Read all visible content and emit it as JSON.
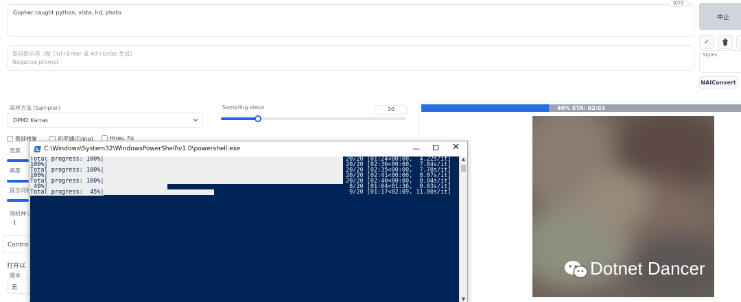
{
  "prompt": {
    "value": "Gopher caught python, vista, hd, photo",
    "counter": "9/75"
  },
  "negative": {
    "line1": "反向提示词（按 Ctrl+Enter 或 Alt+Enter 生成）",
    "line2": "Negative prompt"
  },
  "right_panel": {
    "interrupt": "中止",
    "styles_label": "Styles",
    "naiconvert": "NAIConvert",
    "check_icon": "✓",
    "trash_icon": "trash"
  },
  "sampler": {
    "label": "采样方法 (Sampler)",
    "value": "DPM2 Karras"
  },
  "steps": {
    "label": "Sampling steps",
    "value": "20",
    "fraction": 0.2
  },
  "checks": {
    "restore": "面部修复",
    "tiling": "可平铺(Tiling)",
    "hires": "Hires. fix"
  },
  "left_labels": {
    "width": "宽度",
    "height": "高度",
    "cfg": "提示词相",
    "seed": "随机种子",
    "seed_value": "-1",
    "controlnet": "ControlN",
    "open": "打开以",
    "script": "脚本",
    "script_value": "无"
  },
  "progress": {
    "text": "40% ETA: 02:03",
    "fraction": 0.4
  },
  "watermark": "Dotnet Dancer",
  "powershell": {
    "title": "C:\\Windows\\System32\\WindowsPowerShell\\v1.0\\powershell.exe",
    "lines": [
      {
        "left": "Total progress: 100%|",
        "right": "20/20 [01:24<00:00,  4.22s/it]"
      },
      {
        "left": "100%|",
        "right": "20/20 [02:36<00:00,  7.84s/it]"
      },
      {
        "left": "Total progress: 100%|",
        "right": "20/20 [02:35<00:00,  7.78s/it]"
      },
      {
        "left": "100%|",
        "right": "20/20 [02:41<00:00,  8.07s/it]"
      },
      {
        "left": "Total progress: 100%|",
        "right": "20/20 [02:40<00:00,  8.04s/it]"
      },
      {
        "left": " 40%|",
        "right": " 8/20 [01:04<01:36,  8.03s/it]"
      },
      {
        "left": "Total progress:  45%|",
        "right": " 9/20 [01:17<02:09, 11.80s/it]"
      }
    ]
  }
}
